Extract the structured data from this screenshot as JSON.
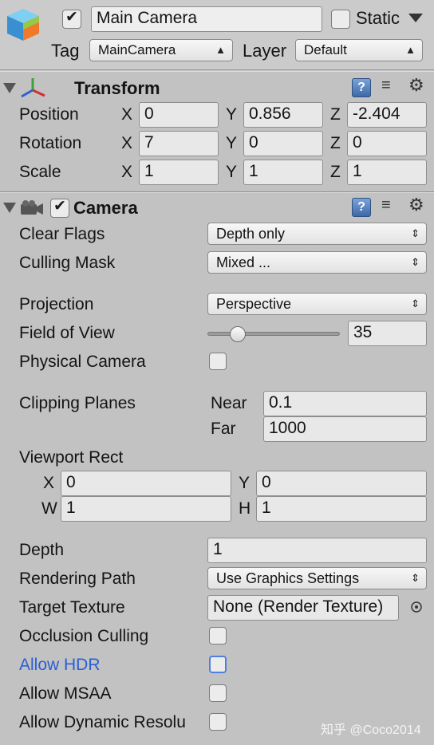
{
  "header": {
    "object_name": "Main Camera",
    "static_label": "Static",
    "tag_label": "Tag",
    "tag_value": "MainCamera",
    "layer_label": "Layer",
    "layer_value": "Default"
  },
  "transform": {
    "title": "Transform",
    "position_label": "Position",
    "rotation_label": "Rotation",
    "scale_label": "Scale",
    "x_label": "X",
    "y_label": "Y",
    "z_label": "Z",
    "position": {
      "x": "0",
      "y": "0.856",
      "z": "-2.404"
    },
    "rotation": {
      "x": "7",
      "y": "0",
      "z": "0"
    },
    "scale": {
      "x": "1",
      "y": "1",
      "z": "1"
    }
  },
  "camera": {
    "title": "Camera",
    "clear_flags_label": "Clear Flags",
    "clear_flags_value": "Depth only",
    "culling_mask_label": "Culling Mask",
    "culling_mask_value": "Mixed ...",
    "projection_label": "Projection",
    "projection_value": "Perspective",
    "fov_label": "Field of View",
    "fov_value": "35",
    "fov_slider_fraction": 0.194,
    "physical_camera_label": "Physical Camera",
    "clipping_label": "Clipping Planes",
    "near_label": "Near",
    "near_value": "0.1",
    "far_label": "Far",
    "far_value": "1000",
    "viewport_label": "Viewport Rect",
    "vp_x_label": "X",
    "vp_y_label": "Y",
    "vp_w_label": "W",
    "vp_h_label": "H",
    "vp_x": "0",
    "vp_y": "0",
    "vp_w": "1",
    "vp_h": "1",
    "depth_label": "Depth",
    "depth_value": "1",
    "rendering_path_label": "Rendering Path",
    "rendering_path_value": "Use Graphics Settings",
    "target_texture_label": "Target Texture",
    "target_texture_value": "None (Render Texture)",
    "occlusion_label": "Occlusion Culling",
    "allow_hdr_label": "Allow HDR",
    "allow_msaa_label": "Allow MSAA",
    "allow_dynamic_label": "Allow Dynamic Resolu"
  },
  "watermark": "知乎 @Coco2014",
  "colors": {
    "allow_hdr_text": "#2a5fd6",
    "background": "#c2c2c2"
  }
}
